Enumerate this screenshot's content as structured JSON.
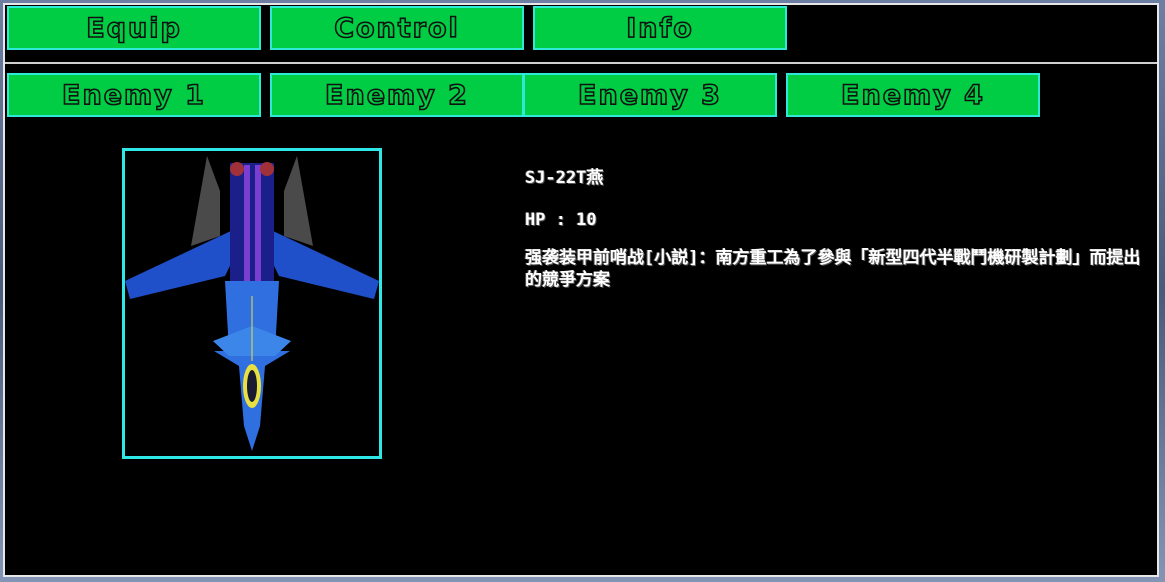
{
  "menu": {
    "tabs": [
      {
        "label": "Equip"
      },
      {
        "label": "Control"
      },
      {
        "label": "Info"
      }
    ]
  },
  "enemy_tabs": [
    {
      "label": "Enemy 1"
    },
    {
      "label": "Enemy 2"
    },
    {
      "label": "Enemy 3"
    },
    {
      "label": "Enemy 4"
    }
  ],
  "enemy": {
    "name": "SJ-22T燕",
    "hp": "HP : 10",
    "description": "强袭装甲前哨战[小説]：南方重工為了參與「新型四代半戰鬥機研製計劃」而提出的競爭方案",
    "image_icon": "fighter-jet-sprite"
  },
  "colors": {
    "button_fill": "#00cc44",
    "button_border": "#2ee8d8",
    "panel_bg": "#000000",
    "frame_border": "#2ee8e8"
  }
}
